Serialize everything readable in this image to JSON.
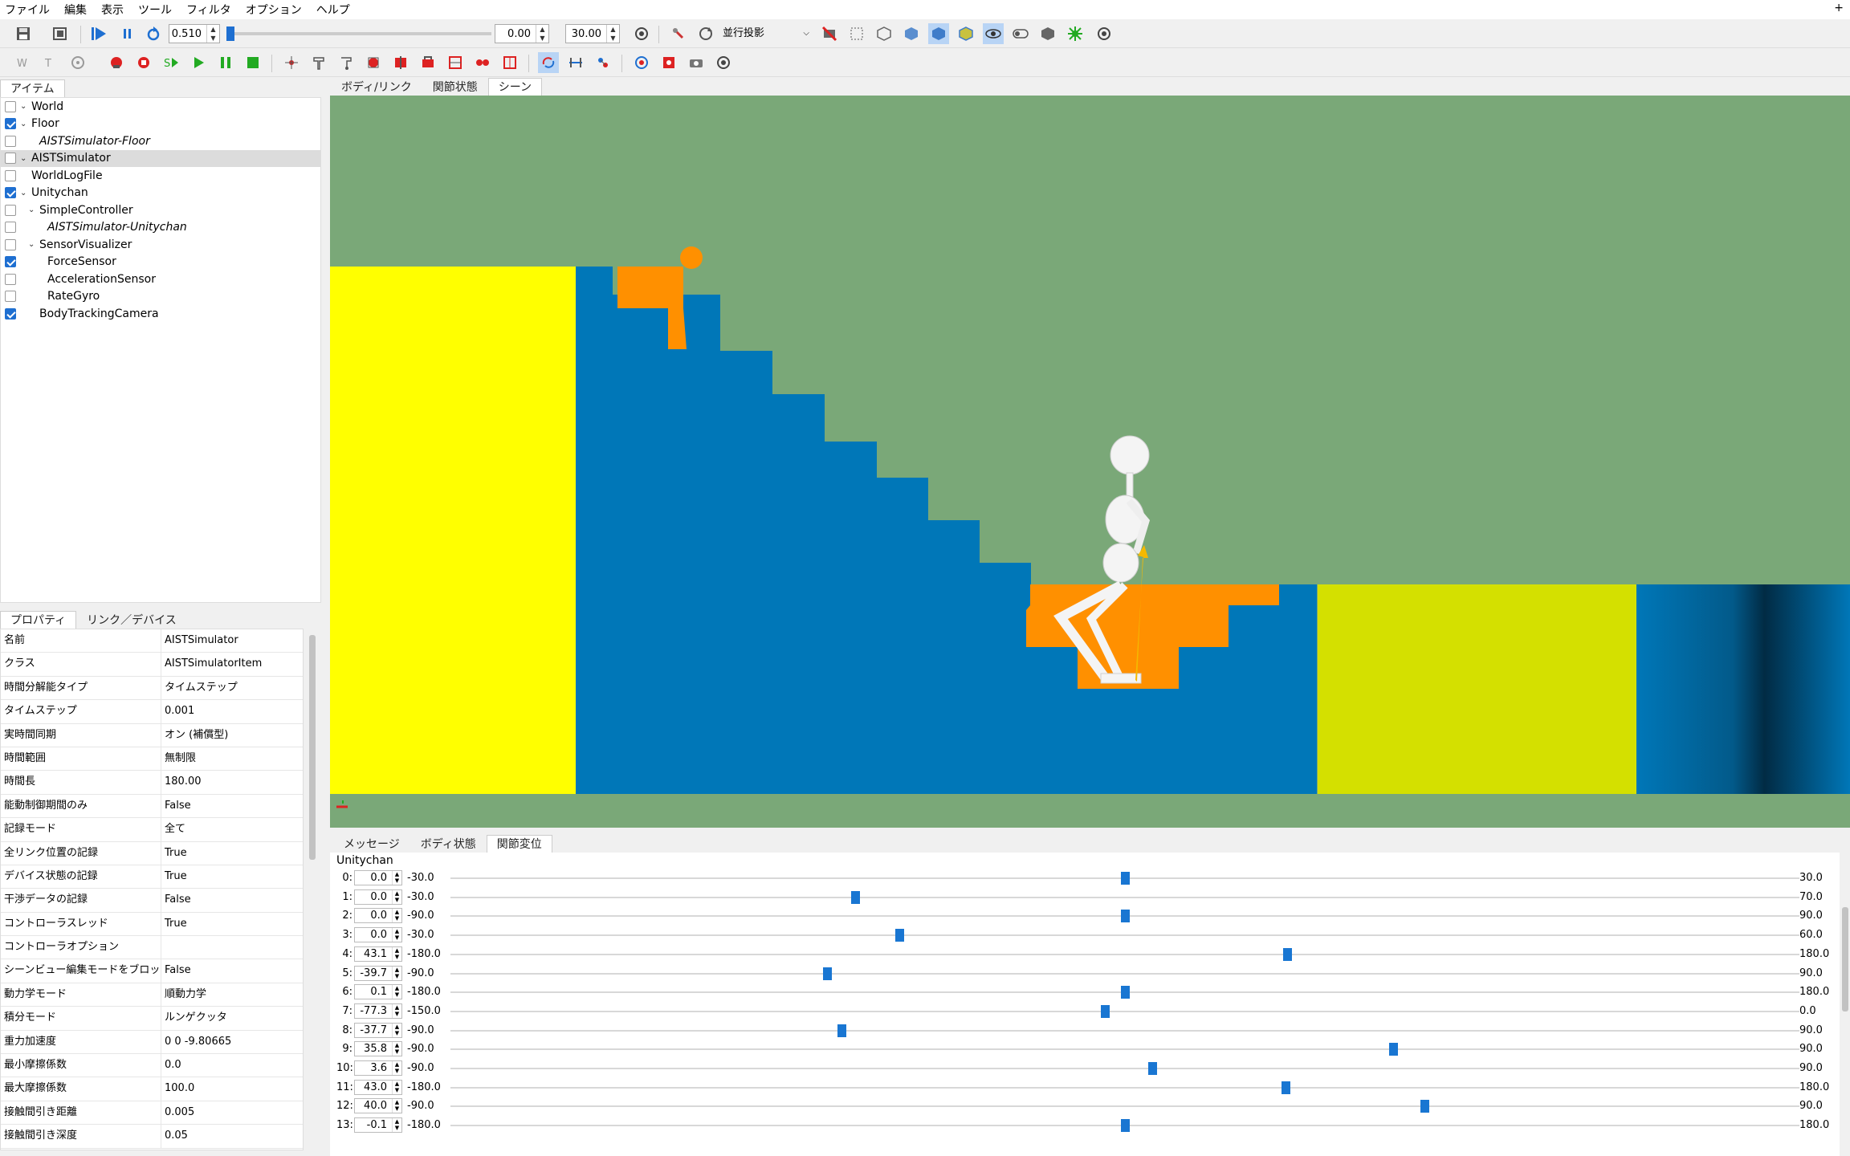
{
  "menu": [
    "ファイル",
    "編集",
    "表示",
    "ツール",
    "フィルタ",
    "オプション",
    "ヘルプ"
  ],
  "menu_plus": "+",
  "toolbar": {
    "time_step": "0.510",
    "start_time": "0.00",
    "end_time": "30.00",
    "projection": "並行投影",
    "accent": "#1e6fd1"
  },
  "left_tabs": {
    "items": "アイテム"
  },
  "tree": [
    {
      "label": "World",
      "checked": false,
      "chev": true,
      "indent": 0,
      "italic": false
    },
    {
      "label": "Floor",
      "checked": true,
      "chev": true,
      "indent": 0,
      "italic": false
    },
    {
      "label": "AISTSimulator-Floor",
      "checked": false,
      "chev": false,
      "indent": 2,
      "italic": true
    },
    {
      "label": "AISTSimulator",
      "checked": false,
      "chev": true,
      "indent": 0,
      "italic": false,
      "selected": true
    },
    {
      "label": "WorldLogFile",
      "checked": false,
      "chev": false,
      "indent": 1,
      "italic": false
    },
    {
      "label": "Unitychan",
      "checked": true,
      "chev": true,
      "indent": 0,
      "italic": false
    },
    {
      "label": "SimpleController",
      "checked": false,
      "chev": true,
      "indent": 1,
      "italic": false
    },
    {
      "label": "AISTSimulator-Unitychan",
      "checked": false,
      "chev": false,
      "indent": 3,
      "italic": true
    },
    {
      "label": "SensorVisualizer",
      "checked": false,
      "chev": true,
      "indent": 1,
      "italic": false
    },
    {
      "label": "ForceSensor",
      "checked": true,
      "chev": false,
      "indent": 3,
      "italic": false
    },
    {
      "label": "AccelerationSensor",
      "checked": false,
      "chev": false,
      "indent": 3,
      "italic": false
    },
    {
      "label": "RateGyro",
      "checked": false,
      "chev": false,
      "indent": 3,
      "italic": false
    },
    {
      "label": "BodyTrackingCamera",
      "checked": true,
      "chev": false,
      "indent": 2,
      "italic": false
    }
  ],
  "prop_tabs": [
    "プロパティ",
    "リンク／デバイス"
  ],
  "properties": [
    [
      "名前",
      "AISTSimulator"
    ],
    [
      "クラス",
      "AISTSimulatorItem"
    ],
    [
      "時間分解能タイプ",
      "タイムステップ"
    ],
    [
      "タイムステップ",
      "0.001"
    ],
    [
      "実時間同期",
      "オン (補償型)"
    ],
    [
      "時間範囲",
      "無制限"
    ],
    [
      "時間長",
      "180.00"
    ],
    [
      "能動制御期間のみ",
      "False"
    ],
    [
      "記録モード",
      "全て"
    ],
    [
      "全リンク位置の記録",
      "True"
    ],
    [
      "デバイス状態の記録",
      "True"
    ],
    [
      "干渉データの記録",
      "False"
    ],
    [
      "コントローラスレッド",
      "True"
    ],
    [
      "コントローラオプション",
      ""
    ],
    [
      "シーンビュー編集モードをブロック",
      "False"
    ],
    [
      "動力学モード",
      "順動力学"
    ],
    [
      "積分モード",
      "ルンゲクッタ"
    ],
    [
      "重力加速度",
      "0 0 -9.80665"
    ],
    [
      "最小摩擦係数",
      "0.0"
    ],
    [
      "最大摩擦係数",
      "100.0"
    ],
    [
      "接触間引き距離",
      "0.005"
    ],
    [
      "接触間引き深度",
      "0.05"
    ]
  ],
  "view_tabs": [
    "ボディ/リンク",
    "関節状態",
    "シーン"
  ],
  "bottom_tabs": [
    "メッセージ",
    "ボディ状態",
    "関節変位"
  ],
  "joints_title": "Unitychan",
  "joints": [
    {
      "i": "0:",
      "v": "0.0",
      "min": "-30.0",
      "max": "30.0",
      "level": 0.5
    },
    {
      "i": "1:",
      "v": "0.0",
      "min": "-30.0",
      "max": "70.0",
      "level": 0.3
    },
    {
      "i": "2:",
      "v": "0.0",
      "min": "-90.0",
      "max": "90.0",
      "level": 0.5
    },
    {
      "i": "3:",
      "v": "0.0",
      "min": "-30.0",
      "max": "60.0",
      "level": 0.333
    },
    {
      "i": "4:",
      "v": "43.1",
      "min": "-180.0",
      "max": "180.0",
      "level": 0.62
    },
    {
      "i": "5:",
      "v": "-39.7",
      "min": "-90.0",
      "max": "90.0",
      "level": 0.279
    },
    {
      "i": "6:",
      "v": "0.1",
      "min": "-180.0",
      "max": "180.0",
      "level": 0.5
    },
    {
      "i": "7:",
      "v": "-77.3",
      "min": "-150.0",
      "max": "0.0",
      "level": 0.485
    },
    {
      "i": "8:",
      "v": "-37.7",
      "min": "-90.0",
      "max": "90.0",
      "level": 0.29
    },
    {
      "i": "9:",
      "v": "35.8",
      "min": "-90.0",
      "max": "90.0",
      "level": 0.699
    },
    {
      "i": "10:",
      "v": "3.6",
      "min": "-90.0",
      "max": "90.0",
      "level": 0.52
    },
    {
      "i": "11:",
      "v": "43.0",
      "min": "-180.0",
      "max": "180.0",
      "level": 0.619
    },
    {
      "i": "12:",
      "v": "40.0",
      "min": "-90.0",
      "max": "90.0",
      "level": 0.722
    },
    {
      "i": "13:",
      "v": "-0.1",
      "min": "-180.0",
      "max": "180.0",
      "level": 0.5
    }
  ],
  "colors": {
    "sky": "#7aa878",
    "stairs": "#0077b8",
    "yellow": "#ffff00",
    "lime": "#d4e000",
    "orange": "#ff9000",
    "slider": "#1976d2"
  }
}
